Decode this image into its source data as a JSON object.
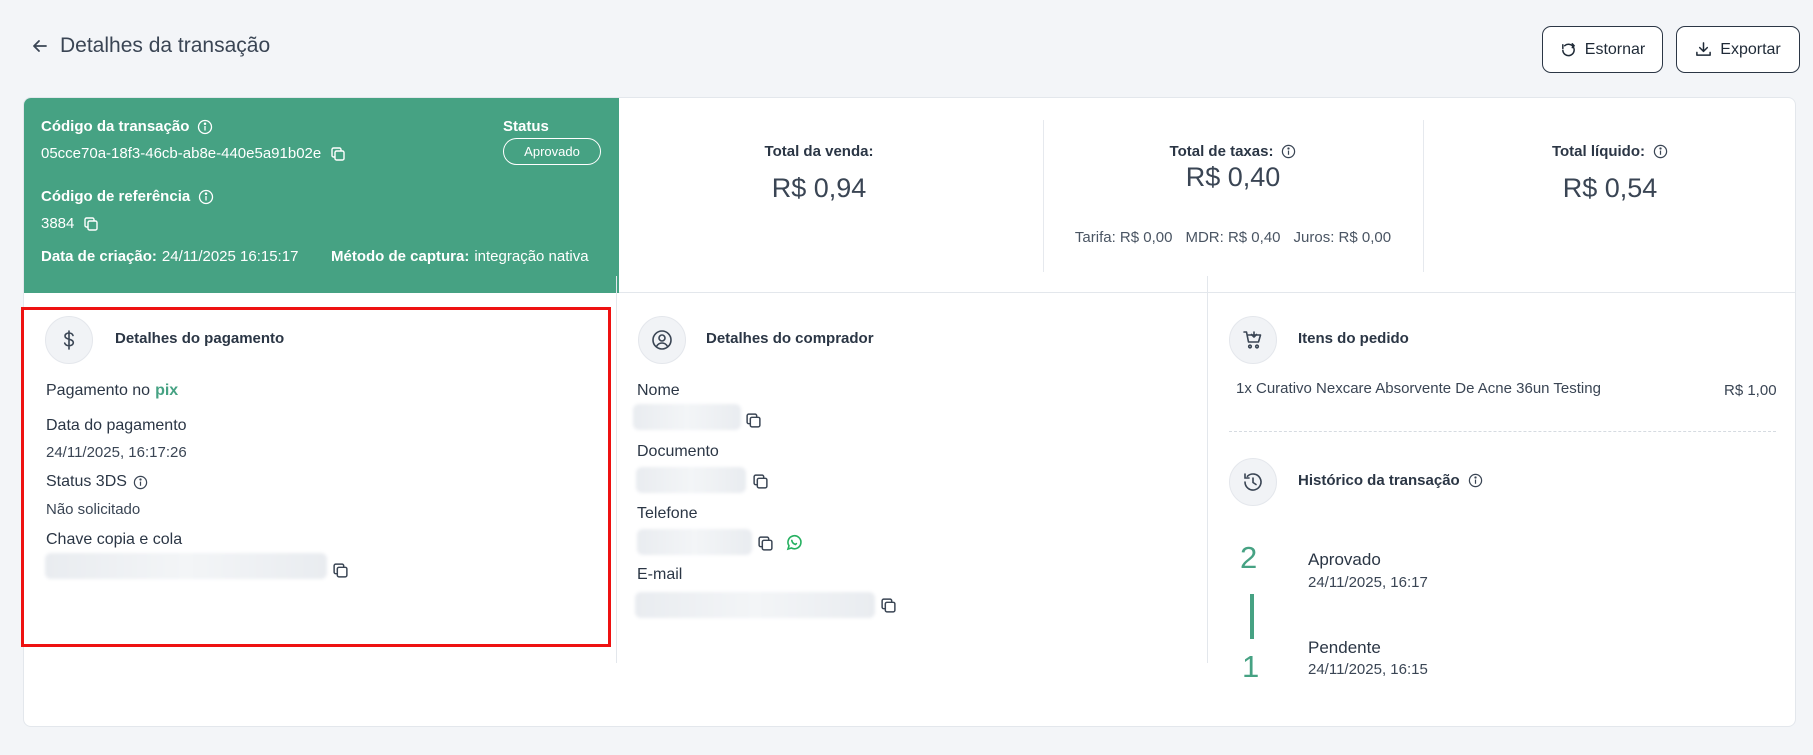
{
  "header": {
    "title": "Detalhes da transação",
    "buttons": {
      "estornar": "Estornar",
      "exportar": "Exportar"
    }
  },
  "transaction": {
    "code_label": "Código da transação",
    "code_value": "05cce70a-18f3-46cb-ab8e-440e5a91b02e",
    "status_label": "Status",
    "status_value": "Aprovado",
    "reference_label": "Código de referência",
    "reference_value": "3884",
    "created_label": "Data de criação:",
    "created_value": "24/11/2025 16:15:17",
    "capture_label": "Método de captura:",
    "capture_value": "integração nativa"
  },
  "totals": {
    "sale": {
      "label": "Total da venda:",
      "value": "R$ 0,94"
    },
    "fees": {
      "label": "Total de taxas:",
      "value": "R$ 0,40",
      "breakdown": [
        "Tarifa: R$ 0,00",
        "MDR: R$ 0,40",
        "Juros: R$ 0,00"
      ]
    },
    "net": {
      "label": "Total líquido:",
      "value": "R$ 0,54"
    }
  },
  "payment": {
    "title": "Detalhes do pagamento",
    "method_prefix": "Pagamento no",
    "method": "pix",
    "date_label": "Data do pagamento",
    "date_value": "24/11/2025, 16:17:26",
    "status3ds_label": "Status 3DS",
    "status3ds_value": "Não solicitado",
    "key_label": "Chave copia e cola"
  },
  "buyer": {
    "title": "Detalhes do comprador",
    "name_label": "Nome",
    "document_label": "Documento",
    "phone_label": "Telefone",
    "email_label": "E-mail"
  },
  "order": {
    "title": "Itens do pedido",
    "items": [
      {
        "desc": "1x Curativo Nexcare Absorvente De Acne 36un Testing",
        "price": "R$ 1,00"
      }
    ]
  },
  "history": {
    "title": "Histórico da transação",
    "entries": [
      {
        "num": "2",
        "status": "Aprovado",
        "date": "24/11/2025, 16:17"
      },
      {
        "num": "1",
        "status": "Pendente",
        "date": "24/11/2025, 16:15"
      }
    ]
  },
  "colors": {
    "accent": "#46a283",
    "highlight": "#ee1111"
  }
}
